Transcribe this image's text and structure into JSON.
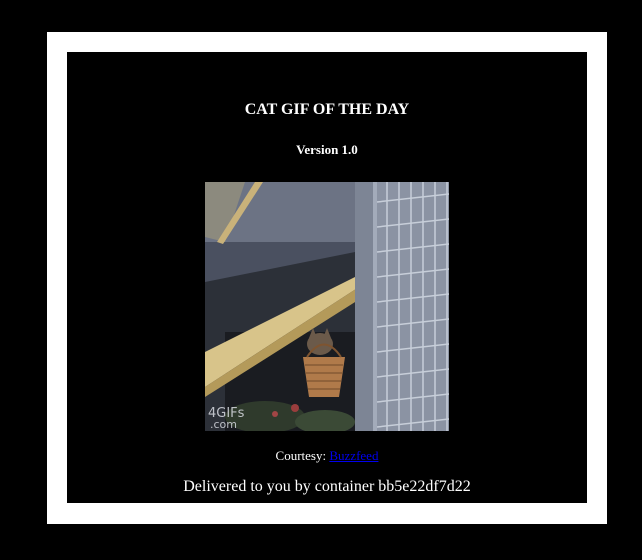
{
  "page": {
    "title": "CAT GIF OF THE DAY",
    "version": "Version 1.0",
    "image": {
      "alt": "Cat peeking out of a basket under an awning",
      "watermark_line1": "4GIFs",
      "watermark_line2": ".com"
    },
    "courtesy_label": "Courtesy:",
    "courtesy_link": "Buzzfeed",
    "delivered": "Delivered to you by container bb5e22df7d22"
  },
  "colors": {
    "background": "#000000",
    "frame": "#ffffff",
    "text": "#ffffff",
    "link": "#0000ee"
  }
}
